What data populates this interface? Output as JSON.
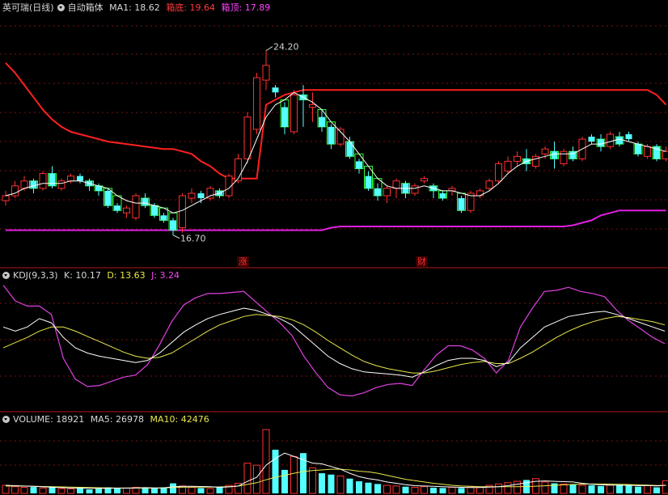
{
  "header": {
    "title": "英可瑞(日线)",
    "indicator_name": "自动箱体",
    "ma1_label": "MA1: 18.62",
    "box_bottom_label": "箱底: 19.64",
    "box_top_label": "箱顶: 17.89"
  },
  "kdj_header": {
    "name": "KDJ(9,3,3)",
    "k": "K: 10.17",
    "d": "D: 13.63",
    "j": "J: 3.24"
  },
  "vol_header": {
    "name": "VOLUME: 18921",
    "ma5": "MA5: 26978",
    "ma10": "MA10: 42476"
  },
  "colors": {
    "up": "#ff3030",
    "down": "#54ffff",
    "box_top": "#ff2020",
    "box_bottom": "#e020e0",
    "ma": "#ffffff",
    "k": "#ffffff",
    "d": "#e8e84a",
    "j": "#e040e0",
    "cloud": "#30ff30"
  },
  "chart_data": {
    "type": "candlestick",
    "price_ylim": [
      15.8,
      25.6
    ],
    "annotations": {
      "high_label": "24.20",
      "low_label": "16.70",
      "marker_up": "涨",
      "marker_fin": "财"
    },
    "candles": [
      {
        "o": 18.1,
        "c": 18.3,
        "h": 18.5,
        "l": 17.9
      },
      {
        "o": 18.3,
        "c": 18.7,
        "h": 18.9,
        "l": 18.2
      },
      {
        "o": 18.6,
        "c": 18.9,
        "h": 19.1,
        "l": 18.5
      },
      {
        "o": 18.9,
        "c": 18.6,
        "h": 19.0,
        "l": 18.4
      },
      {
        "o": 18.6,
        "c": 19.2,
        "h": 19.3,
        "l": 18.5
      },
      {
        "o": 19.2,
        "c": 18.7,
        "h": 19.5,
        "l": 18.6
      },
      {
        "o": 18.6,
        "c": 18.9,
        "h": 19.0,
        "l": 18.5
      },
      {
        "o": 18.9,
        "c": 19.1,
        "h": 19.2,
        "l": 18.8
      },
      {
        "o": 19.1,
        "c": 18.9,
        "h": 19.2,
        "l": 18.8
      },
      {
        "o": 18.9,
        "c": 18.7,
        "h": 19.0,
        "l": 18.5
      },
      {
        "o": 18.7,
        "c": 18.5,
        "h": 18.8,
        "l": 18.3
      },
      {
        "o": 18.5,
        "c": 17.9,
        "h": 18.6,
        "l": 17.8
      },
      {
        "o": 17.9,
        "c": 17.7,
        "h": 18.0,
        "l": 17.6
      },
      {
        "o": 17.6,
        "c": 17.8,
        "h": 17.9,
        "l": 17.4
      },
      {
        "o": 17.4,
        "c": 18.3,
        "h": 18.4,
        "l": 17.3
      },
      {
        "o": 18.2,
        "c": 17.9,
        "h": 18.4,
        "l": 17.8
      },
      {
        "o": 17.9,
        "c": 17.5,
        "h": 18.0,
        "l": 17.4
      },
      {
        "o": 17.5,
        "c": 17.3,
        "h": 17.6,
        "l": 17.2
      },
      {
        "o": 17.3,
        "c": 16.9,
        "h": 17.4,
        "l": 16.7
      },
      {
        "o": 17.0,
        "c": 18.3,
        "h": 18.4,
        "l": 16.8
      },
      {
        "o": 18.2,
        "c": 18.4,
        "h": 18.6,
        "l": 18.0
      },
      {
        "o": 18.4,
        "c": 18.2,
        "h": 18.5,
        "l": 18.0
      },
      {
        "o": 18.2,
        "c": 18.6,
        "h": 18.7,
        "l": 18.1
      },
      {
        "o": 18.5,
        "c": 18.3,
        "h": 18.6,
        "l": 18.2
      },
      {
        "o": 18.3,
        "c": 19.1,
        "h": 19.2,
        "l": 18.2
      },
      {
        "o": 18.9,
        "c": 19.8,
        "h": 20.0,
        "l": 18.8
      },
      {
        "o": 19.8,
        "c": 21.5,
        "h": 21.7,
        "l": 19.6
      },
      {
        "o": 21.0,
        "c": 23.1,
        "h": 23.3,
        "l": 20.8
      },
      {
        "o": 23.0,
        "c": 23.6,
        "h": 24.2,
        "l": 22.6
      },
      {
        "o": 22.7,
        "c": 22.5,
        "h": 22.8,
        "l": 22.3
      },
      {
        "o": 21.9,
        "c": 21.1,
        "h": 22.1,
        "l": 20.8
      },
      {
        "o": 20.9,
        "c": 22.4,
        "h": 22.6,
        "l": 20.8
      },
      {
        "o": 22.4,
        "c": 22.2,
        "h": 22.8,
        "l": 21.1
      },
      {
        "o": 21.9,
        "c": 22.0,
        "h": 22.5,
        "l": 21.3
      },
      {
        "o": 21.5,
        "c": 21.1,
        "h": 21.8,
        "l": 20.9
      },
      {
        "o": 21.1,
        "c": 20.4,
        "h": 21.2,
        "l": 20.2
      },
      {
        "o": 20.4,
        "c": 21.0,
        "h": 21.1,
        "l": 20.3
      },
      {
        "o": 20.5,
        "c": 19.9,
        "h": 20.7,
        "l": 19.8
      },
      {
        "o": 19.7,
        "c": 19.4,
        "h": 19.8,
        "l": 19.2
      },
      {
        "o": 19.1,
        "c": 18.6,
        "h": 19.3,
        "l": 18.5
      },
      {
        "o": 18.6,
        "c": 18.3,
        "h": 18.8,
        "l": 18.1
      },
      {
        "o": 18.3,
        "c": 18.6,
        "h": 18.7,
        "l": 18.0
      },
      {
        "o": 18.6,
        "c": 18.9,
        "h": 19.0,
        "l": 18.2
      },
      {
        "o": 18.8,
        "c": 18.4,
        "h": 18.9,
        "l": 18.2
      },
      {
        "o": 18.4,
        "c": 18.7,
        "h": 18.8,
        "l": 18.3
      },
      {
        "o": 18.9,
        "c": 19.0,
        "h": 19.1,
        "l": 18.8
      },
      {
        "o": 18.7,
        "c": 18.5,
        "h": 18.8,
        "l": 18.2
      },
      {
        "o": 18.4,
        "c": 18.2,
        "h": 18.5,
        "l": 18.1
      },
      {
        "o": 18.5,
        "c": 18.6,
        "h": 18.7,
        "l": 18.3
      },
      {
        "o": 18.2,
        "c": 17.7,
        "h": 18.3,
        "l": 17.6
      },
      {
        "o": 17.7,
        "c": 18.4,
        "h": 18.5,
        "l": 17.6
      },
      {
        "o": 18.3,
        "c": 18.5,
        "h": 18.6,
        "l": 18.2
      },
      {
        "o": 18.6,
        "c": 18.9,
        "h": 19.0,
        "l": 18.5
      },
      {
        "o": 18.9,
        "c": 19.6,
        "h": 19.7,
        "l": 18.8
      },
      {
        "o": 19.3,
        "c": 19.7,
        "h": 19.9,
        "l": 19.2
      },
      {
        "o": 19.7,
        "c": 19.9,
        "h": 20.1,
        "l": 19.5
      },
      {
        "o": 19.8,
        "c": 19.6,
        "h": 20.2,
        "l": 19.3
      },
      {
        "o": 19.5,
        "c": 19.9,
        "h": 20.0,
        "l": 19.4
      },
      {
        "o": 20.0,
        "c": 20.2,
        "h": 20.3,
        "l": 19.8
      },
      {
        "o": 20.1,
        "c": 19.8,
        "h": 20.5,
        "l": 19.4
      },
      {
        "o": 19.6,
        "c": 20.1,
        "h": 20.2,
        "l": 19.5
      },
      {
        "o": 20.1,
        "c": 19.8,
        "h": 20.3,
        "l": 19.7
      },
      {
        "o": 19.8,
        "c": 20.6,
        "h": 20.7,
        "l": 19.7
      },
      {
        "o": 20.7,
        "c": 20.5,
        "h": 20.8,
        "l": 20.4
      },
      {
        "o": 20.6,
        "c": 20.3,
        "h": 20.8,
        "l": 20.1
      },
      {
        "o": 20.3,
        "c": 20.8,
        "h": 20.9,
        "l": 20.2
      },
      {
        "o": 20.7,
        "c": 20.4,
        "h": 20.9,
        "l": 20.3
      },
      {
        "o": 20.8,
        "c": 20.6,
        "h": 20.9,
        "l": 20.5
      },
      {
        "o": 20.4,
        "c": 20.0,
        "h": 20.5,
        "l": 19.9
      },
      {
        "o": 19.9,
        "c": 20.3,
        "h": 20.4,
        "l": 19.8
      },
      {
        "o": 20.3,
        "c": 19.8,
        "h": 20.4,
        "l": 19.7
      },
      {
        "o": 19.8,
        "c": 20.1,
        "h": 20.3,
        "l": 19.7
      }
    ],
    "ma1": [
      18.3,
      18.4,
      18.6,
      18.7,
      18.8,
      18.8,
      18.8,
      18.9,
      18.9,
      18.8,
      18.7,
      18.6,
      18.3,
      18.1,
      18.0,
      18.0,
      17.9,
      17.8,
      17.6,
      17.7,
      17.9,
      18.1,
      18.3,
      18.4,
      18.6,
      19.0,
      19.7,
      20.6,
      21.5,
      22.0,
      22.2,
      22.5,
      22.3,
      22.1,
      21.8,
      21.3,
      20.9,
      20.5,
      20.0,
      19.5,
      19.0,
      18.7,
      18.6,
      18.6,
      18.6,
      18.7,
      18.6,
      18.5,
      18.5,
      18.4,
      18.3,
      18.3,
      18.5,
      18.8,
      19.2,
      19.5,
      19.7,
      19.8,
      19.9,
      20.0,
      20.0,
      20.0,
      20.2,
      20.4,
      20.4,
      20.5,
      20.6,
      20.5,
      20.4,
      20.3,
      20.2,
      20.1
    ],
    "box_top": [
      23.7,
      23.3,
      22.8,
      22.3,
      21.8,
      21.4,
      21.1,
      20.9,
      20.8,
      20.7,
      20.6,
      20.5,
      20.45,
      20.4,
      20.35,
      20.3,
      20.25,
      20.2,
      20.2,
      20.1,
      20.0,
      19.7,
      19.5,
      19.2,
      19.0,
      19.0,
      19.0,
      19.0,
      22.0,
      22.2,
      22.4,
      22.5,
      22.6,
      22.6,
      22.6,
      22.6,
      22.6,
      22.6,
      22.6,
      22.6,
      22.6,
      22.6,
      22.6,
      22.6,
      22.6,
      22.6,
      22.6,
      22.6,
      22.6,
      22.6,
      22.6,
      22.6,
      22.6,
      22.6,
      22.6,
      22.6,
      22.6,
      22.6,
      22.6,
      22.6,
      22.6,
      22.6,
      22.6,
      22.6,
      22.6,
      22.6,
      22.6,
      22.6,
      22.6,
      22.6,
      22.4,
      22.0
    ],
    "box_bottom": [
      16.9,
      16.9,
      16.9,
      16.9,
      16.9,
      16.9,
      16.9,
      16.9,
      16.9,
      16.9,
      16.9,
      16.9,
      16.9,
      16.9,
      16.9,
      16.9,
      16.9,
      16.9,
      16.9,
      16.9,
      16.9,
      16.9,
      16.9,
      16.9,
      16.9,
      16.9,
      16.9,
      16.9,
      16.9,
      16.9,
      16.9,
      16.9,
      16.9,
      16.9,
      16.9,
      17.0,
      17.05,
      17.05,
      17.05,
      17.05,
      17.05,
      17.05,
      17.05,
      17.05,
      17.05,
      17.05,
      17.05,
      17.05,
      17.05,
      17.05,
      17.05,
      17.05,
      17.05,
      17.05,
      17.05,
      17.05,
      17.05,
      17.05,
      17.05,
      17.05,
      17.05,
      17.1,
      17.2,
      17.3,
      17.5,
      17.6,
      17.7,
      17.7,
      17.7,
      17.7,
      17.7,
      17.7
    ],
    "kdj_ylim": [
      -8,
      112
    ],
    "k": [
      70,
      66,
      70,
      78,
      74,
      60,
      50,
      45,
      42,
      40,
      38,
      36,
      38,
      45,
      55,
      65,
      72,
      78,
      82,
      85,
      88,
      86,
      82,
      78,
      72,
      62,
      52,
      42,
      35,
      30,
      27,
      26,
      25,
      24,
      22,
      27,
      33,
      38,
      40,
      40,
      38,
      32,
      36,
      50,
      60,
      70,
      75,
      80,
      82,
      84,
      85,
      82,
      78,
      74,
      70,
      66
    ],
    "d": [
      50,
      55,
      60,
      66,
      70,
      70,
      66,
      61,
      56,
      51,
      46,
      42,
      40,
      41,
      45,
      52,
      59,
      66,
      72,
      76,
      80,
      82,
      81,
      80,
      77,
      72,
      65,
      57,
      50,
      43,
      37,
      33,
      30,
      28,
      26,
      26,
      28,
      31,
      34,
      36,
      37,
      35,
      35,
      40,
      46,
      53,
      60,
      66,
      71,
      75,
      78,
      80,
      79,
      77,
      75,
      72
    ],
    "j": [
      110,
      95,
      90,
      90,
      82,
      40,
      20,
      13,
      14,
      18,
      22,
      24,
      34,
      53,
      75,
      91,
      98,
      102,
      102,
      103,
      104,
      94,
      84,
      74,
      62,
      42,
      26,
      12,
      5,
      4,
      7,
      12,
      15,
      16,
      14,
      29,
      43,
      52,
      52,
      48,
      40,
      26,
      38,
      70,
      88,
      104,
      105,
      108,
      104,
      102,
      99,
      86,
      76,
      68,
      60,
      54
    ],
    "vol_ylim": [
      0,
      100000
    ],
    "volume": [
      12000,
      10000,
      9000,
      9500,
      8000,
      9000,
      7000,
      6500,
      8000,
      6000,
      7000,
      9000,
      7500,
      8000,
      9000,
      8000,
      7500,
      9000,
      15000,
      11000,
      9000,
      8000,
      7000,
      9000,
      12000,
      15000,
      45000,
      42000,
      95000,
      65000,
      35000,
      55000,
      60000,
      38000,
      30000,
      28000,
      26000,
      22000,
      18000,
      16000,
      14000,
      12000,
      11000,
      10000,
      9000,
      10000,
      8500,
      8000,
      9000,
      8000,
      9500,
      9000,
      12000,
      14000,
      16000,
      18000,
      20000,
      22000,
      17000,
      15000,
      14000,
      13000,
      12000,
      12000,
      11000,
      12000,
      13000,
      12000,
      10000,
      12000,
      9000,
      18921
    ],
    "vol_ma5": [
      12000,
      11500,
      11000,
      10500,
      9700,
      9100,
      8500,
      8000,
      8000,
      7700,
      7300,
      7700,
      7800,
      7800,
      8200,
      8500,
      8100,
      8300,
      9800,
      10500,
      10500,
      10200,
      10000,
      9000,
      9600,
      11000,
      18000,
      24000,
      42000,
      52000,
      60000,
      55000,
      50000,
      45000,
      44000,
      40000,
      36000,
      30000,
      25000,
      22000,
      20000,
      17000,
      15000,
      13000,
      11500,
      11000,
      10500,
      10000,
      9500,
      9000,
      8800,
      8700,
      9400,
      10000,
      11500,
      13600,
      16000,
      18000,
      18600,
      18000,
      17500,
      17000,
      15000,
      13500,
      12800,
      12400,
      12000,
      12000,
      11600,
      11800,
      11200,
      12000
    ],
    "vol_ma10": [
      11000,
      11000,
      10800,
      10600,
      10300,
      10000,
      9600,
      9300,
      9000,
      8700,
      8400,
      8200,
      8000,
      7900,
      7900,
      8000,
      8000,
      8100,
      8700,
      9100,
      9300,
      9300,
      9400,
      9600,
      10100,
      10800,
      13400,
      15900,
      20300,
      24000,
      27000,
      30000,
      32500,
      34000,
      35000,
      36000,
      36000,
      35000,
      33000,
      32000,
      30000,
      27000,
      24000,
      21000,
      19000,
      17000,
      15000,
      13500,
      12000,
      11000,
      10500,
      10000,
      10000,
      10000,
      10000,
      10000,
      10300,
      10700,
      11300,
      12000,
      12700,
      13400,
      13700,
      14000,
      14000,
      13800,
      13500,
      13200,
      12600,
      12300,
      11800,
      12000
    ]
  }
}
